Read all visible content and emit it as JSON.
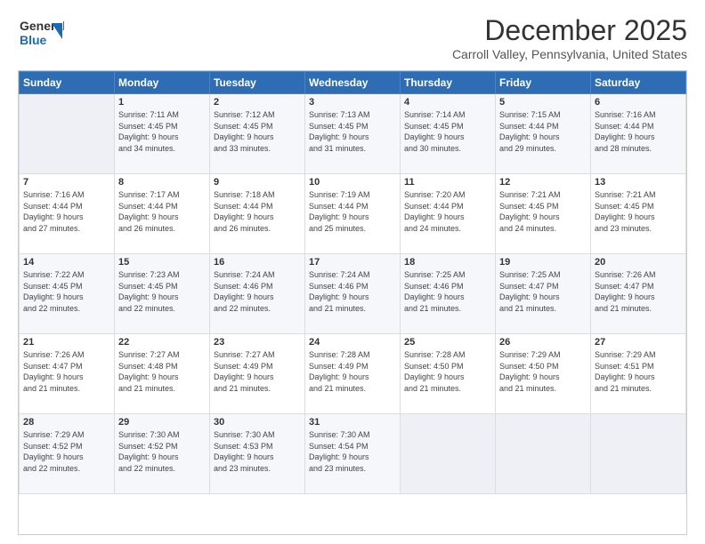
{
  "header": {
    "logo_line1": "General",
    "logo_line2": "Blue",
    "title": "December 2025",
    "subtitle": "Carroll Valley, Pennsylvania, United States"
  },
  "calendar": {
    "weekdays": [
      "Sunday",
      "Monday",
      "Tuesday",
      "Wednesday",
      "Thursday",
      "Friday",
      "Saturday"
    ],
    "weeks": [
      [
        {
          "day": "",
          "lines": []
        },
        {
          "day": "1",
          "lines": [
            "Sunrise: 7:11 AM",
            "Sunset: 4:45 PM",
            "Daylight: 9 hours",
            "and 34 minutes."
          ]
        },
        {
          "day": "2",
          "lines": [
            "Sunrise: 7:12 AM",
            "Sunset: 4:45 PM",
            "Daylight: 9 hours",
            "and 33 minutes."
          ]
        },
        {
          "day": "3",
          "lines": [
            "Sunrise: 7:13 AM",
            "Sunset: 4:45 PM",
            "Daylight: 9 hours",
            "and 31 minutes."
          ]
        },
        {
          "day": "4",
          "lines": [
            "Sunrise: 7:14 AM",
            "Sunset: 4:45 PM",
            "Daylight: 9 hours",
            "and 30 minutes."
          ]
        },
        {
          "day": "5",
          "lines": [
            "Sunrise: 7:15 AM",
            "Sunset: 4:44 PM",
            "Daylight: 9 hours",
            "and 29 minutes."
          ]
        },
        {
          "day": "6",
          "lines": [
            "Sunrise: 7:16 AM",
            "Sunset: 4:44 PM",
            "Daylight: 9 hours",
            "and 28 minutes."
          ]
        }
      ],
      [
        {
          "day": "7",
          "lines": [
            "Sunrise: 7:16 AM",
            "Sunset: 4:44 PM",
            "Daylight: 9 hours",
            "and 27 minutes."
          ]
        },
        {
          "day": "8",
          "lines": [
            "Sunrise: 7:17 AM",
            "Sunset: 4:44 PM",
            "Daylight: 9 hours",
            "and 26 minutes."
          ]
        },
        {
          "day": "9",
          "lines": [
            "Sunrise: 7:18 AM",
            "Sunset: 4:44 PM",
            "Daylight: 9 hours",
            "and 26 minutes."
          ]
        },
        {
          "day": "10",
          "lines": [
            "Sunrise: 7:19 AM",
            "Sunset: 4:44 PM",
            "Daylight: 9 hours",
            "and 25 minutes."
          ]
        },
        {
          "day": "11",
          "lines": [
            "Sunrise: 7:20 AM",
            "Sunset: 4:44 PM",
            "Daylight: 9 hours",
            "and 24 minutes."
          ]
        },
        {
          "day": "12",
          "lines": [
            "Sunrise: 7:21 AM",
            "Sunset: 4:45 PM",
            "Daylight: 9 hours",
            "and 24 minutes."
          ]
        },
        {
          "day": "13",
          "lines": [
            "Sunrise: 7:21 AM",
            "Sunset: 4:45 PM",
            "Daylight: 9 hours",
            "and 23 minutes."
          ]
        }
      ],
      [
        {
          "day": "14",
          "lines": [
            "Sunrise: 7:22 AM",
            "Sunset: 4:45 PM",
            "Daylight: 9 hours",
            "and 22 minutes."
          ]
        },
        {
          "day": "15",
          "lines": [
            "Sunrise: 7:23 AM",
            "Sunset: 4:45 PM",
            "Daylight: 9 hours",
            "and 22 minutes."
          ]
        },
        {
          "day": "16",
          "lines": [
            "Sunrise: 7:24 AM",
            "Sunset: 4:46 PM",
            "Daylight: 9 hours",
            "and 22 minutes."
          ]
        },
        {
          "day": "17",
          "lines": [
            "Sunrise: 7:24 AM",
            "Sunset: 4:46 PM",
            "Daylight: 9 hours",
            "and 21 minutes."
          ]
        },
        {
          "day": "18",
          "lines": [
            "Sunrise: 7:25 AM",
            "Sunset: 4:46 PM",
            "Daylight: 9 hours",
            "and 21 minutes."
          ]
        },
        {
          "day": "19",
          "lines": [
            "Sunrise: 7:25 AM",
            "Sunset: 4:47 PM",
            "Daylight: 9 hours",
            "and 21 minutes."
          ]
        },
        {
          "day": "20",
          "lines": [
            "Sunrise: 7:26 AM",
            "Sunset: 4:47 PM",
            "Daylight: 9 hours",
            "and 21 minutes."
          ]
        }
      ],
      [
        {
          "day": "21",
          "lines": [
            "Sunrise: 7:26 AM",
            "Sunset: 4:47 PM",
            "Daylight: 9 hours",
            "and 21 minutes."
          ]
        },
        {
          "day": "22",
          "lines": [
            "Sunrise: 7:27 AM",
            "Sunset: 4:48 PM",
            "Daylight: 9 hours",
            "and 21 minutes."
          ]
        },
        {
          "day": "23",
          "lines": [
            "Sunrise: 7:27 AM",
            "Sunset: 4:49 PM",
            "Daylight: 9 hours",
            "and 21 minutes."
          ]
        },
        {
          "day": "24",
          "lines": [
            "Sunrise: 7:28 AM",
            "Sunset: 4:49 PM",
            "Daylight: 9 hours",
            "and 21 minutes."
          ]
        },
        {
          "day": "25",
          "lines": [
            "Sunrise: 7:28 AM",
            "Sunset: 4:50 PM",
            "Daylight: 9 hours",
            "and 21 minutes."
          ]
        },
        {
          "day": "26",
          "lines": [
            "Sunrise: 7:29 AM",
            "Sunset: 4:50 PM",
            "Daylight: 9 hours",
            "and 21 minutes."
          ]
        },
        {
          "day": "27",
          "lines": [
            "Sunrise: 7:29 AM",
            "Sunset: 4:51 PM",
            "Daylight: 9 hours",
            "and 21 minutes."
          ]
        }
      ],
      [
        {
          "day": "28",
          "lines": [
            "Sunrise: 7:29 AM",
            "Sunset: 4:52 PM",
            "Daylight: 9 hours",
            "and 22 minutes."
          ]
        },
        {
          "day": "29",
          "lines": [
            "Sunrise: 7:30 AM",
            "Sunset: 4:52 PM",
            "Daylight: 9 hours",
            "and 22 minutes."
          ]
        },
        {
          "day": "30",
          "lines": [
            "Sunrise: 7:30 AM",
            "Sunset: 4:53 PM",
            "Daylight: 9 hours",
            "and 23 minutes."
          ]
        },
        {
          "day": "31",
          "lines": [
            "Sunrise: 7:30 AM",
            "Sunset: 4:54 PM",
            "Daylight: 9 hours",
            "and 23 minutes."
          ]
        },
        {
          "day": "",
          "lines": []
        },
        {
          "day": "",
          "lines": []
        },
        {
          "day": "",
          "lines": []
        }
      ]
    ]
  }
}
